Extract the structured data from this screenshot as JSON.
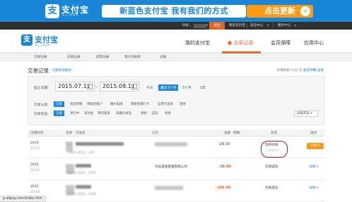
{
  "banner": {
    "logo_glyph": "支",
    "brand": "支付宝",
    "brand_sub": "ALIPAY",
    "slogan": "新蓝色支付宝 我有我们的方式",
    "cta": "点击更新",
    "close_glyph": "»",
    "bg_color": "#1a86d8",
    "cta_color": "#ff9a16"
  },
  "topbar": {
    "greeting": "你好，",
    "logout": "退出",
    "my_alipay": "我的支付宝",
    "security_center": "安全中心",
    "dropdown_glyph": "▾",
    "service_center": "服务中心"
  },
  "header": {
    "logo_glyph": "支",
    "logo": "支付宝",
    "logo_sub": "ALIPAY",
    "nav": [
      "我的支付宝",
      "交易记录",
      "会员保障",
      "应用中心"
    ],
    "active_nav_index": 1,
    "accent": "#e8672c"
  },
  "subnav": [
    "交易记录",
    "充值记录",
    "提现记录",
    "电子对账单",
    "记账"
  ],
  "page": {
    "title": "交易记录",
    "switch_version": "切换到旧版本",
    "balance_label": "可用余额",
    "balance_amount": "0.00",
    "balance_unit": "元",
    "balance_link": "收支明细",
    "balance_link2": "查看"
  },
  "filter": {
    "date_label": "起止日期:",
    "start_date": "2015.07.11",
    "end_date": "2015.08.11",
    "date_sep": "-",
    "quick": [
      "今天",
      "最近1个月",
      "3个月",
      "1年"
    ],
    "quick_selected": 1,
    "type_label": "交易分类:",
    "types": [
      "全部",
      "淘宝购物",
      "转账到账户",
      "缴水电煤",
      "转账到银行卡",
      "信用卡还款",
      "理财"
    ],
    "status_label": "交易状态:",
    "statuses": [
      "全部",
      "进行中",
      "未付款",
      "等待发货",
      "未确认收货",
      "退款",
      "成功",
      "失败"
    ],
    "advanced": "高级筛选 ▾"
  },
  "table": {
    "headers": [
      "创建时间",
      "名称",
      "交易号",
      "对方",
      "金额",
      "明细",
      "状态",
      "操作"
    ],
    "rows": [
      {
        "date": "2015",
        "time": "13:13",
        "trade_no": "交易号 2015…107",
        "counterpart": "",
        "amount": "-29.20",
        "status": "等待付款",
        "status_sub": "已申请代付",
        "action": "付款 ▾",
        "highlight": true
      },
      {
        "date": "2015",
        "time": "20:01",
        "trade_no": "流水号 2015…1057",
        "counterpart": "天弘基金管理有限公司",
        "amount": "-38.00",
        "status": "交易成功",
        "action": "详情 ▾"
      },
      {
        "date": "2015",
        "time": "20:02",
        "trade_no": "流水号 2015…5565",
        "counterpart": "",
        "amount": "-106.00",
        "status": "交易成功",
        "action": "详情 ▾"
      }
    ]
  },
  "status_url": "p.alipay.com/index.htm"
}
